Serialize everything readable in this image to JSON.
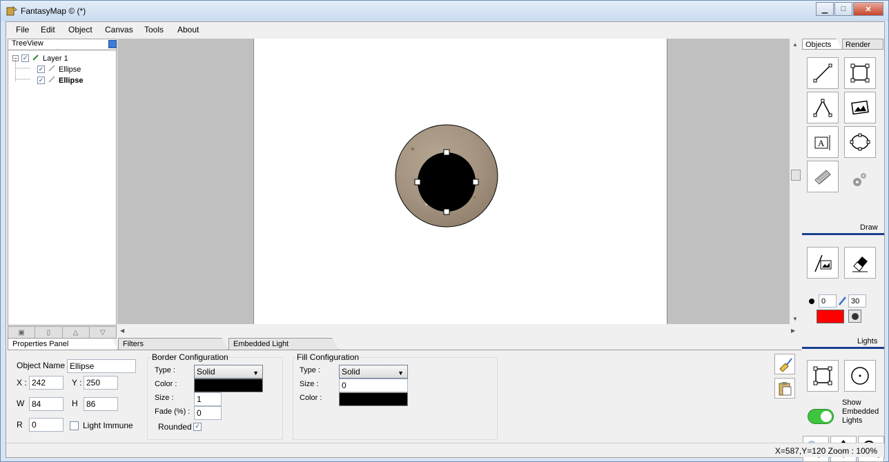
{
  "window": {
    "title": "FantasyMap © (*)"
  },
  "menu": [
    "File",
    "Edit",
    "Object",
    "Canvas",
    "Tools",
    "About"
  ],
  "treeview": {
    "tab_label": "TreeView",
    "nodes": [
      {
        "label": "Layer 1",
        "checked": "✓",
        "expander": "−"
      },
      {
        "label": "Ellipse",
        "checked": "✓"
      },
      {
        "label": "Ellipse",
        "checked": "✓",
        "selected": true
      }
    ]
  },
  "right_panel": {
    "tabs": [
      "Objects",
      "Render"
    ],
    "draw_label": "Draw",
    "lights_label": "Lights",
    "light_size": "0",
    "brush_size": "30",
    "light_color": "#ff0000",
    "show_embedded_lights": "Show Embedded Lights",
    "draw_tools": [
      "line-tool-icon",
      "rectangle-tool-icon",
      "polyline-tool-icon",
      "image-tool-icon",
      "text-tool-icon",
      "ellipse-tool-icon",
      "texture-tool-icon",
      "settings-icon"
    ],
    "bottom_tools": [
      "select-tool-icon",
      "move-tool-icon",
      "zoom-tool-icon"
    ]
  },
  "properties": {
    "tabs": [
      "Properties Panel",
      "Filters",
      "Embedded Light"
    ],
    "object_name_label": "Object Name",
    "object_name": "Ellipse",
    "x_label": "X :",
    "x": "242",
    "y_label": "Y :",
    "y": "250",
    "w_label": "W",
    "w": "84",
    "h_label": "H",
    "h": "86",
    "r_label": "R",
    "r": "0",
    "light_immune_label": "Light Immune",
    "border": {
      "title": "Border Configuration",
      "type_label": "Type :",
      "type": "Solid",
      "color_label": "Color :",
      "color": "#000000",
      "size_label": "Size :",
      "size": "1",
      "fade_label": "Fade (%) :",
      "fade": "0",
      "rounded_label": "Rounded",
      "rounded_check": "✓"
    },
    "fill": {
      "title": "Fill Configuration",
      "type_label": "Type :",
      "type": "Solid",
      "size_label": "Size :",
      "size": "0",
      "color_label": "Color :",
      "color": "#000000"
    }
  },
  "status": {
    "text": "X=587,Y=120  Zoom : 100%"
  }
}
